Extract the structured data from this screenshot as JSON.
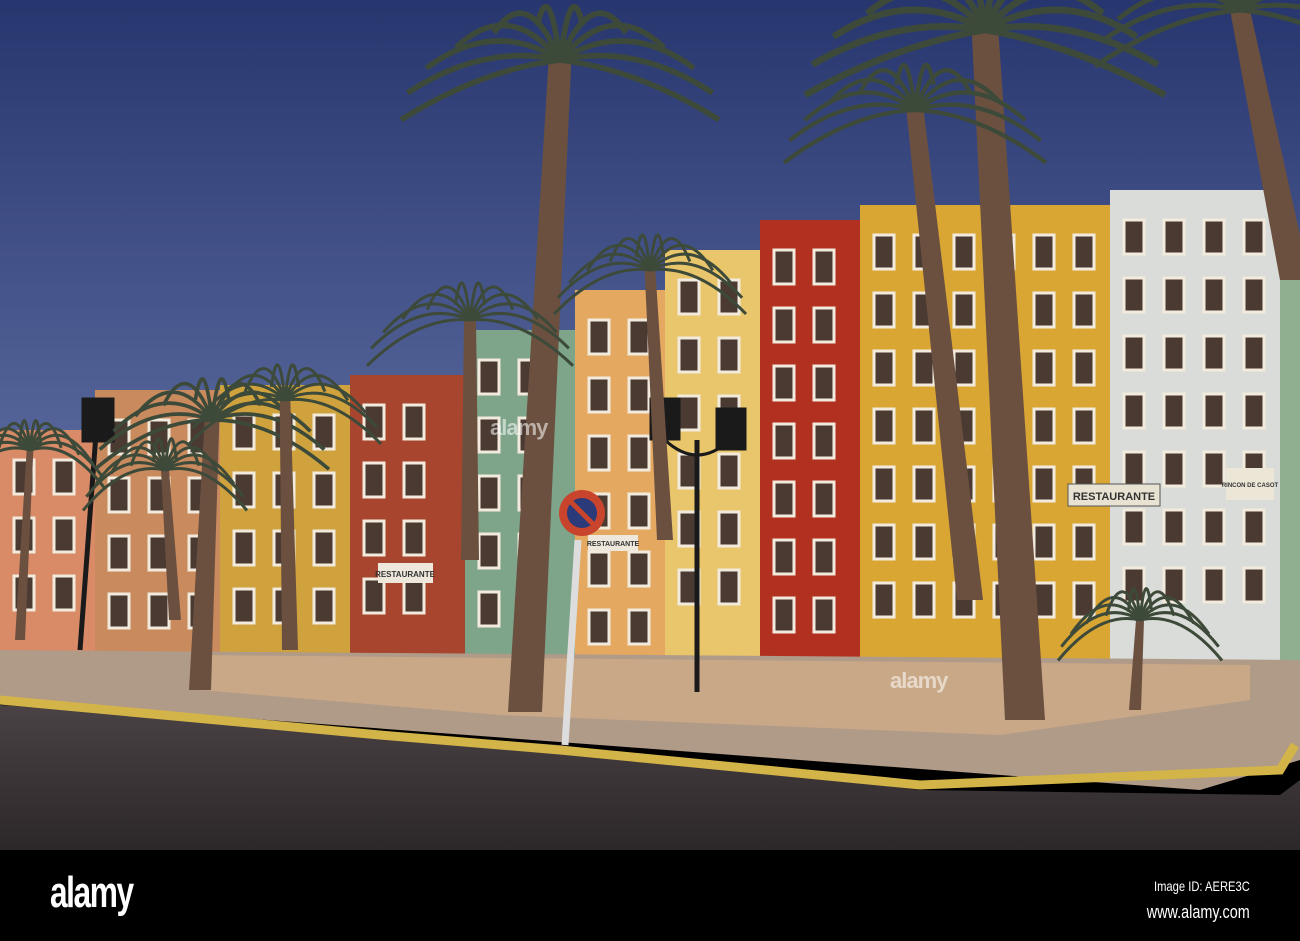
{
  "photo": {
    "subject": "Colourful houses and palm trees, Villajoyosa seafront",
    "signs": [
      "RESTAURANTE",
      "RESTAURANTE",
      "RESTAURANTE",
      "RINCON DE CASOT"
    ],
    "colors": {
      "sky_top": "#2a3a78",
      "sky_bottom": "#6a7cb0",
      "road": "#3a3436",
      "walk": "#a9968a",
      "curb": "#d0b040"
    }
  },
  "watermark": {
    "center_text": "alamy"
  },
  "footer": {
    "logo": "alamy",
    "image_id": "Image ID: AERE3C",
    "url": "www.alamy.com"
  }
}
